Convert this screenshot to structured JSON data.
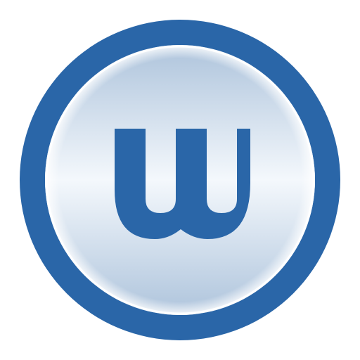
{
  "logo": {
    "icon": "w-letter-badge-icon",
    "letter": "w",
    "colors": {
      "ring": "#2a66a8",
      "ring_edge": "#2e6aac",
      "face_top": "#aec4dc",
      "face_mid": "#f4f8fc",
      "face_bottom": "#aec4dc",
      "face_rim": "#ffffff",
      "letter": "#2a66a8",
      "background": "#ffffff"
    }
  }
}
